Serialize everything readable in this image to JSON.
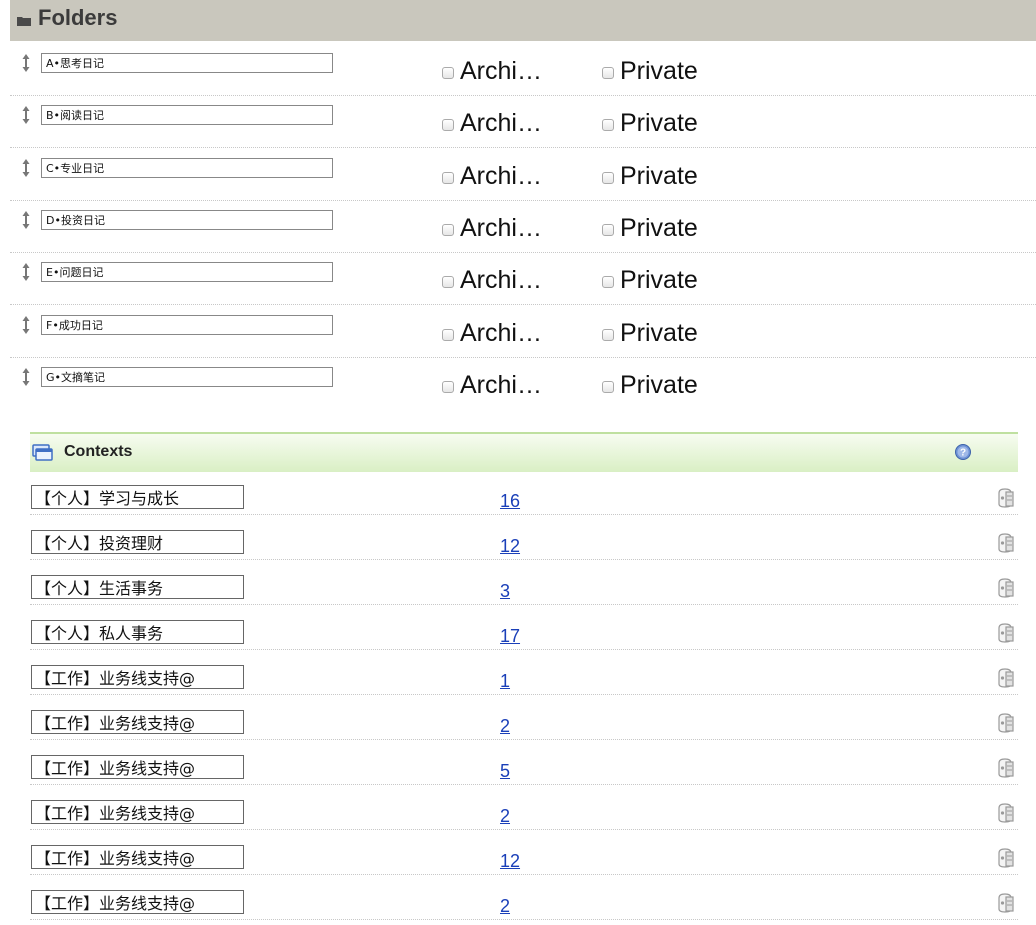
{
  "folders": {
    "title": "Folders",
    "archive_label": "Archi…",
    "private_label": "Private",
    "items": [
      {
        "name": "A•思考日记",
        "archived": false,
        "private": false
      },
      {
        "name": "B•阅读日记",
        "archived": false,
        "private": false
      },
      {
        "name": "C•专业日记",
        "archived": false,
        "private": false
      },
      {
        "name": "D•投资日记",
        "archived": false,
        "private": false
      },
      {
        "name": "E•问题日记",
        "archived": false,
        "private": false
      },
      {
        "name": "F•成功日记",
        "archived": false,
        "private": false
      },
      {
        "name": "G•文摘笔记",
        "archived": false,
        "private": false
      }
    ]
  },
  "contexts": {
    "title": "Contexts",
    "items": [
      {
        "name": "【个人】学习与成长",
        "count": "16"
      },
      {
        "name": "【个人】投资理财",
        "count": "12"
      },
      {
        "name": "【个人】生活事务",
        "count": "3"
      },
      {
        "name": "【个人】私人事务",
        "count": "17"
      },
      {
        "name": "【工作】业务线支持@",
        "count": "1"
      },
      {
        "name": "【工作】业务线支持@",
        "count": "2"
      },
      {
        "name": "【工作】业务线支持@",
        "count": "5"
      },
      {
        "name": "【工作】业务线支持@",
        "count": "2"
      },
      {
        "name": "【工作】业务线支持@",
        "count": "12"
      },
      {
        "name": "【工作】业务线支持@",
        "count": "2"
      }
    ]
  },
  "colors": {
    "folders_header_bg": "#c9c7bd",
    "contexts_header_bg": "#d9efc4",
    "link": "#1a3fb8"
  },
  "icons": {
    "folders_header": "folder-icon",
    "row_handle": "drag-handle-icon",
    "contexts_header": "contexts-icon",
    "help": "help-icon",
    "row_action": "archive-box-icon"
  }
}
